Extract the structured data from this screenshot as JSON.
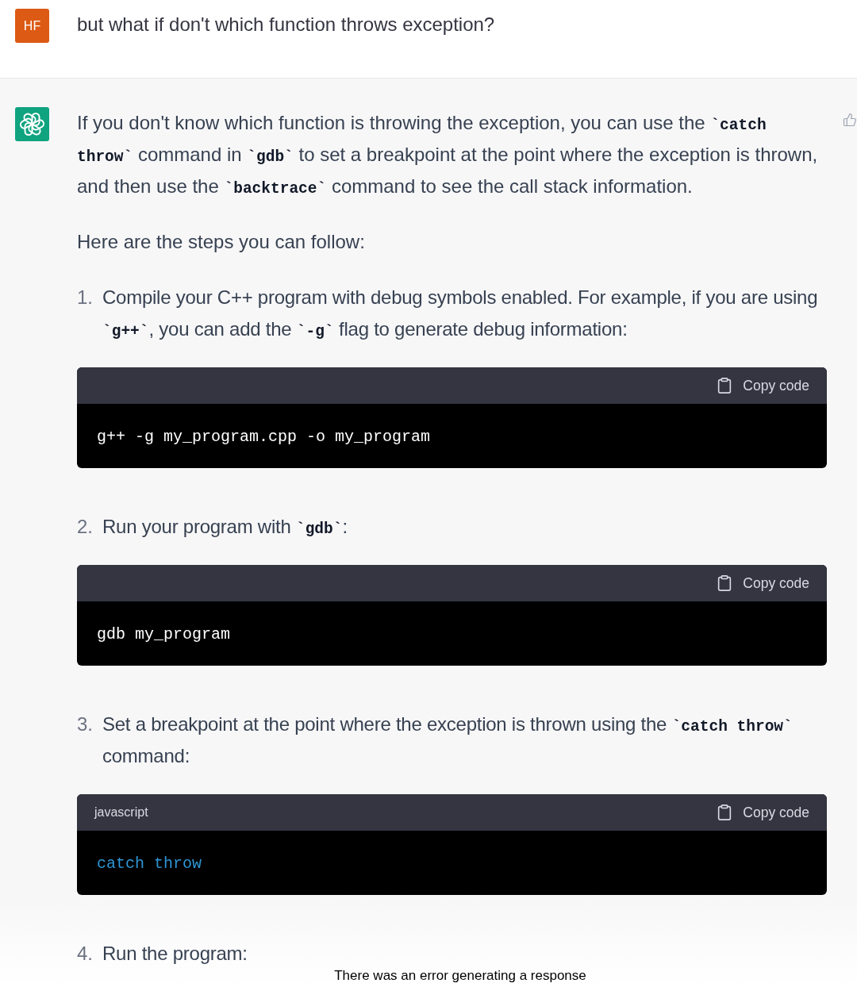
{
  "user_message": {
    "avatar": "HF",
    "text": "but what if don't which function throws exception?"
  },
  "assistant_message": {
    "intro": [
      {
        "kind": "text",
        "text": "If you don't know which function is throwing the exception, you can use the "
      },
      {
        "kind": "code",
        "text": "`catch throw`"
      },
      {
        "kind": "text",
        "text": " command in "
      },
      {
        "kind": "code",
        "text": "`gdb`"
      },
      {
        "kind": "text",
        "text": " to set a breakpoint at the point where the exception is thrown, and then use the "
      },
      {
        "kind": "code",
        "text": "`backtrace`"
      },
      {
        "kind": "text",
        "text": " command to see the call stack information."
      }
    ],
    "lead": "Here are the steps you can follow:",
    "steps": [
      {
        "number": "1.",
        "text": [
          {
            "kind": "text",
            "text": "Compile your C++ program with debug symbols enabled. For example, if you are using "
          },
          {
            "kind": "code",
            "text": "`g++`"
          },
          {
            "kind": "text",
            "text": ", you can add the "
          },
          {
            "kind": "code",
            "text": "`-g`"
          },
          {
            "kind": "text",
            "text": " flag to generate debug information:"
          }
        ],
        "code_block": {
          "copy_label": "Copy code",
          "code": [
            {
              "kind": "plain",
              "text": "g++ -g my_program.cpp -o my_program"
            }
          ]
        }
      },
      {
        "number": "2.",
        "text": [
          {
            "kind": "text",
            "text": "Run your program with "
          },
          {
            "kind": "code",
            "text": "`gdb`"
          },
          {
            "kind": "text",
            "text": ":"
          }
        ],
        "code_block": {
          "copy_label": "Copy code",
          "code": [
            {
              "kind": "plain",
              "text": "gdb my_program"
            }
          ]
        }
      },
      {
        "number": "3.",
        "text": [
          {
            "kind": "text",
            "text": "Set a breakpoint at the point where the exception is thrown using the "
          },
          {
            "kind": "code",
            "text": "`catch throw`"
          },
          {
            "kind": "text",
            "text": " command:"
          }
        ],
        "code_block": {
          "language": "javascript",
          "copy_label": "Copy code",
          "code": [
            {
              "kind": "keyword",
              "text": "catch throw"
            }
          ]
        }
      },
      {
        "number": "4.",
        "text": [
          {
            "kind": "text",
            "text": "Run the program:"
          }
        ]
      }
    ]
  },
  "status": {
    "error": "There was an error generating a response"
  }
}
